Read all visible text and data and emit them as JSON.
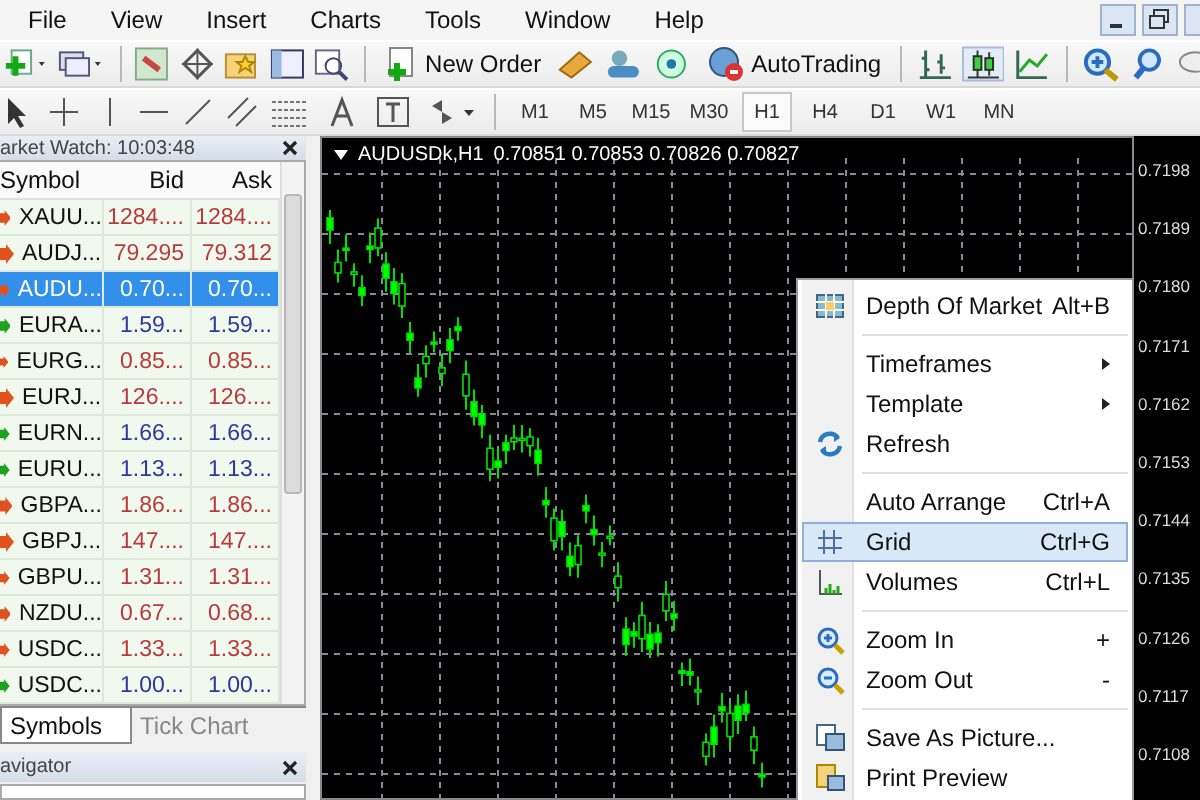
{
  "menu_bar": {
    "items": [
      "File",
      "View",
      "Insert",
      "Charts",
      "Tools",
      "Window",
      "Help"
    ]
  },
  "toolbar": {
    "buttons": [
      {
        "kind": "new-order",
        "label": "New Order"
      },
      {
        "kind": "autotrading",
        "label": "AutoTrading"
      }
    ]
  },
  "timeframes": [
    {
      "label": "M1",
      "selected": false
    },
    {
      "label": "M5",
      "selected": false
    },
    {
      "label": "M15",
      "selected": false
    },
    {
      "label": "M30",
      "selected": false
    },
    {
      "label": "H1",
      "selected": true
    },
    {
      "label": "H4",
      "selected": false
    },
    {
      "label": "D1",
      "selected": false
    },
    {
      "label": "W1",
      "selected": false
    },
    {
      "label": "MN",
      "selected": false
    }
  ],
  "market_watch": {
    "title": "arket Watch: 10:03:48",
    "columns": [
      "Symbol",
      "Bid",
      "Ask"
    ],
    "rows": [
      {
        "symbol": "XAUU...",
        "bid": "1284....",
        "ask": "1284....",
        "up": false,
        "selected": false
      },
      {
        "symbol": "AUDJ...",
        "bid": "79.295",
        "ask": "79.312",
        "up": false,
        "selected": false
      },
      {
        "symbol": "AUDU...",
        "bid": "0.70...",
        "ask": "0.70...",
        "up": false,
        "selected": true
      },
      {
        "symbol": "EURA...",
        "bid": "1.59...",
        "ask": "1.59...",
        "up": true,
        "selected": false
      },
      {
        "symbol": "EURG...",
        "bid": "0.85...",
        "ask": "0.85...",
        "up": false,
        "selected": false
      },
      {
        "symbol": "EURJ...",
        "bid": "126....",
        "ask": "126....",
        "up": false,
        "selected": false
      },
      {
        "symbol": "EURN...",
        "bid": "1.66...",
        "ask": "1.66...",
        "up": true,
        "selected": false
      },
      {
        "symbol": "EURU...",
        "bid": "1.13...",
        "ask": "1.13...",
        "up": true,
        "selected": false
      },
      {
        "symbol": "GBPA...",
        "bid": "1.86...",
        "ask": "1.86...",
        "up": false,
        "selected": false
      },
      {
        "symbol": "GBPJ...",
        "bid": "147....",
        "ask": "147....",
        "up": false,
        "selected": false
      },
      {
        "symbol": "GBPU...",
        "bid": "1.31...",
        "ask": "1.31...",
        "up": false,
        "selected": false
      },
      {
        "symbol": "NZDU...",
        "bid": "0.67...",
        "ask": "0.68...",
        "up": false,
        "selected": false
      },
      {
        "symbol": "USDC...",
        "bid": "1.33...",
        "ask": "1.33...",
        "up": false,
        "selected": false
      },
      {
        "symbol": "USDC...",
        "bid": "1.00...",
        "ask": "1.00...",
        "up": true,
        "selected": false
      }
    ],
    "tabs": [
      {
        "label": "Symbols",
        "selected": true
      },
      {
        "label": "Tick Chart",
        "selected": false
      }
    ]
  },
  "navigator": {
    "title": "avigator"
  },
  "chart": {
    "title": "AUDUSDk,H1",
    "quote": "0.70851 0.70853 0.70826 0.70827",
    "price_labels": [
      "0.7198",
      "0.7189",
      "0.7180",
      "0.7171",
      "0.7162",
      "0.7153",
      "0.7144",
      "0.7135",
      "0.7126",
      "0.7117",
      "0.7108"
    ]
  },
  "context_menu": [
    {
      "kind": "item",
      "label": "Depth Of Market",
      "shortcut": "Alt+B",
      "submenu": false,
      "selected": false
    },
    {
      "kind": "separator"
    },
    {
      "kind": "item",
      "label": "Timeframes",
      "submenu": true,
      "selected": false
    },
    {
      "kind": "item",
      "label": "Template",
      "submenu": true,
      "selected": false
    },
    {
      "kind": "item",
      "label": "Refresh",
      "submenu": false,
      "selected": false
    },
    {
      "kind": "separator"
    },
    {
      "kind": "item",
      "label": "Auto Arrange",
      "shortcut": "Ctrl+A",
      "submenu": false,
      "selected": false
    },
    {
      "kind": "item",
      "label": "Grid",
      "shortcut": "Ctrl+G",
      "submenu": false,
      "selected": true
    },
    {
      "kind": "item",
      "label": "Volumes",
      "shortcut": "Ctrl+L",
      "submenu": false,
      "selected": false
    },
    {
      "kind": "separator"
    },
    {
      "kind": "item",
      "label": "Zoom In",
      "shortcut": "+",
      "submenu": false,
      "selected": false
    },
    {
      "kind": "item",
      "label": "Zoom Out",
      "shortcut": "-",
      "submenu": false,
      "selected": false
    },
    {
      "kind": "separator"
    },
    {
      "kind": "item",
      "label": "Save As Picture...",
      "submenu": false,
      "selected": false
    },
    {
      "kind": "item",
      "label": "Print Preview",
      "submenu": false,
      "selected": false
    }
  ]
}
